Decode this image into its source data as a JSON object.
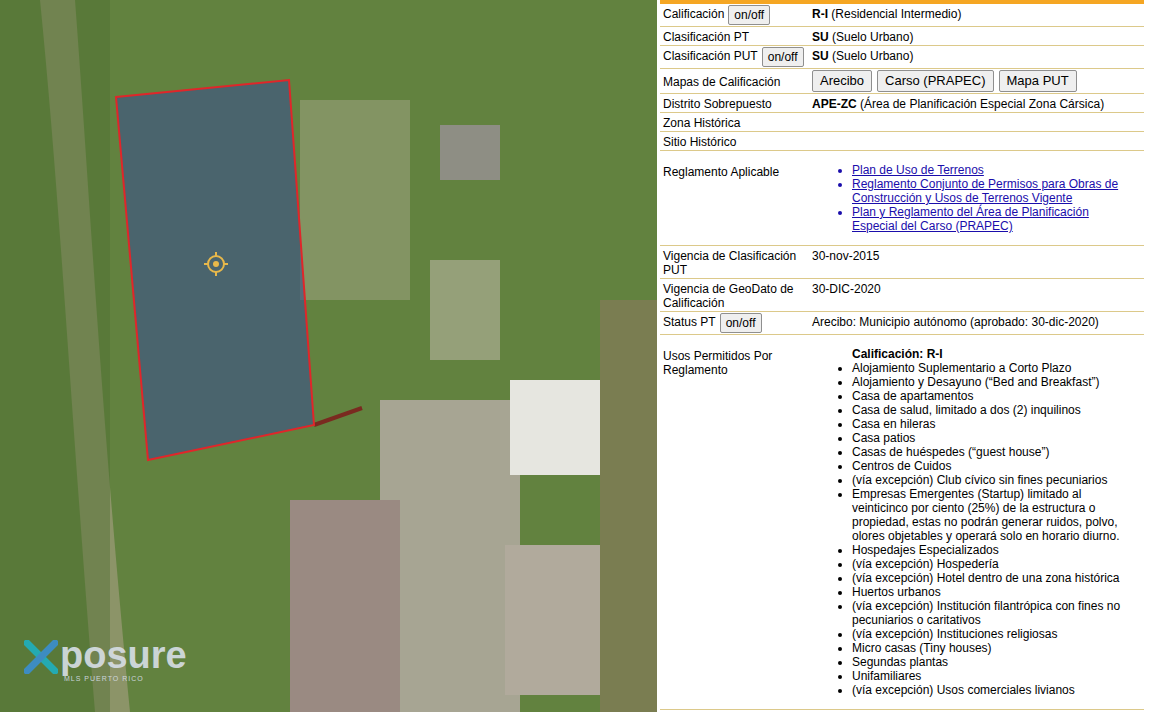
{
  "map": {
    "watermark": {
      "brand": "posure",
      "tagline": "MLS PUERTO RICO"
    }
  },
  "details": {
    "rows": [
      {
        "kind": "coded",
        "label": "Calificación",
        "toggle": "on/off",
        "code": "R-I",
        "desc": "(Residencial Intermedio)"
      },
      {
        "kind": "coded",
        "label": "Clasificación PT",
        "code": "SU",
        "desc": "(Suelo Urbano)"
      },
      {
        "kind": "coded",
        "label": "Clasificación PUT",
        "toggle": "on/off",
        "code": "SU",
        "desc": "(Suelo Urbano)"
      },
      {
        "kind": "buttons",
        "label": "Mapas de Calificación",
        "buttons": [
          "Arecibo",
          "Carso (PRAPEC)",
          "Mapa PUT"
        ]
      },
      {
        "kind": "coded",
        "label": "Distrito Sobrepuesto",
        "code": "APE-ZC",
        "desc": "(Área de Planificación Especial Zona Cársica)"
      },
      {
        "kind": "plain",
        "label": "Zona Histórica",
        "value": ""
      },
      {
        "kind": "plain",
        "label": "Sitio Histórico",
        "value": ""
      },
      {
        "kind": "links",
        "label": "Reglamento Aplicable",
        "links": [
          "Plan de Uso de Terrenos",
          "Reglamento Conjunto de Permisos para Obras de Construcción y Usos de Terrenos Vigente",
          "Plan y Reglamento del Área de Planificación Especial del Carso (PRAPEC)"
        ]
      },
      {
        "kind": "plain",
        "label": "Vigencia de Clasificación PUT",
        "value": "30-nov-2015"
      },
      {
        "kind": "plain",
        "label": "Vigencia de GeoDato de Calificación",
        "value": "30-DIC-2020"
      },
      {
        "kind": "plain",
        "label": "Status PT",
        "toggle": "on/off",
        "value": "Arecibo: Municipio autónomo (aprobado: 30-dic-2020)"
      },
      {
        "kind": "uses",
        "label": "Usos Permitidos Por Reglamento",
        "heading": "Calificación: R-I",
        "items": [
          "Alojamiento Suplementario a Corto Plazo",
          "Alojamiento y Desayuno (“Bed and Breakfast”)",
          "Casa de apartamentos",
          "Casa de salud, limitado a dos (2) inquilinos",
          "Casa en hileras",
          "Casa patios",
          "Casas de huéspedes (“guest house”)",
          "Centros de Cuidos",
          "(vía excepción) Club cívico sin fines pecuniarios",
          "Empresas Emergentes (Startup) limitado al veinticinco por ciento (25%) de la estructura o propiedad, estas no podrán generar ruidos, polvo, olores objetables y operará solo en horario diurno.",
          "Hospedajes Especializados",
          "(vía excepción) Hospedería",
          "(vía excepción) Hotel dentro de una zona histórica",
          "Huertos urbanos",
          "(vía excepción) Institución filantrópica con fines no pecuniarios o caritativos",
          "(vía excepción) Instituciones religiosas",
          "Micro casas (Tiny houses)",
          "Segundas plantas",
          "Unifamiliares",
          "(vía excepción) Usos comerciales livianos"
        ]
      }
    ]
  }
}
